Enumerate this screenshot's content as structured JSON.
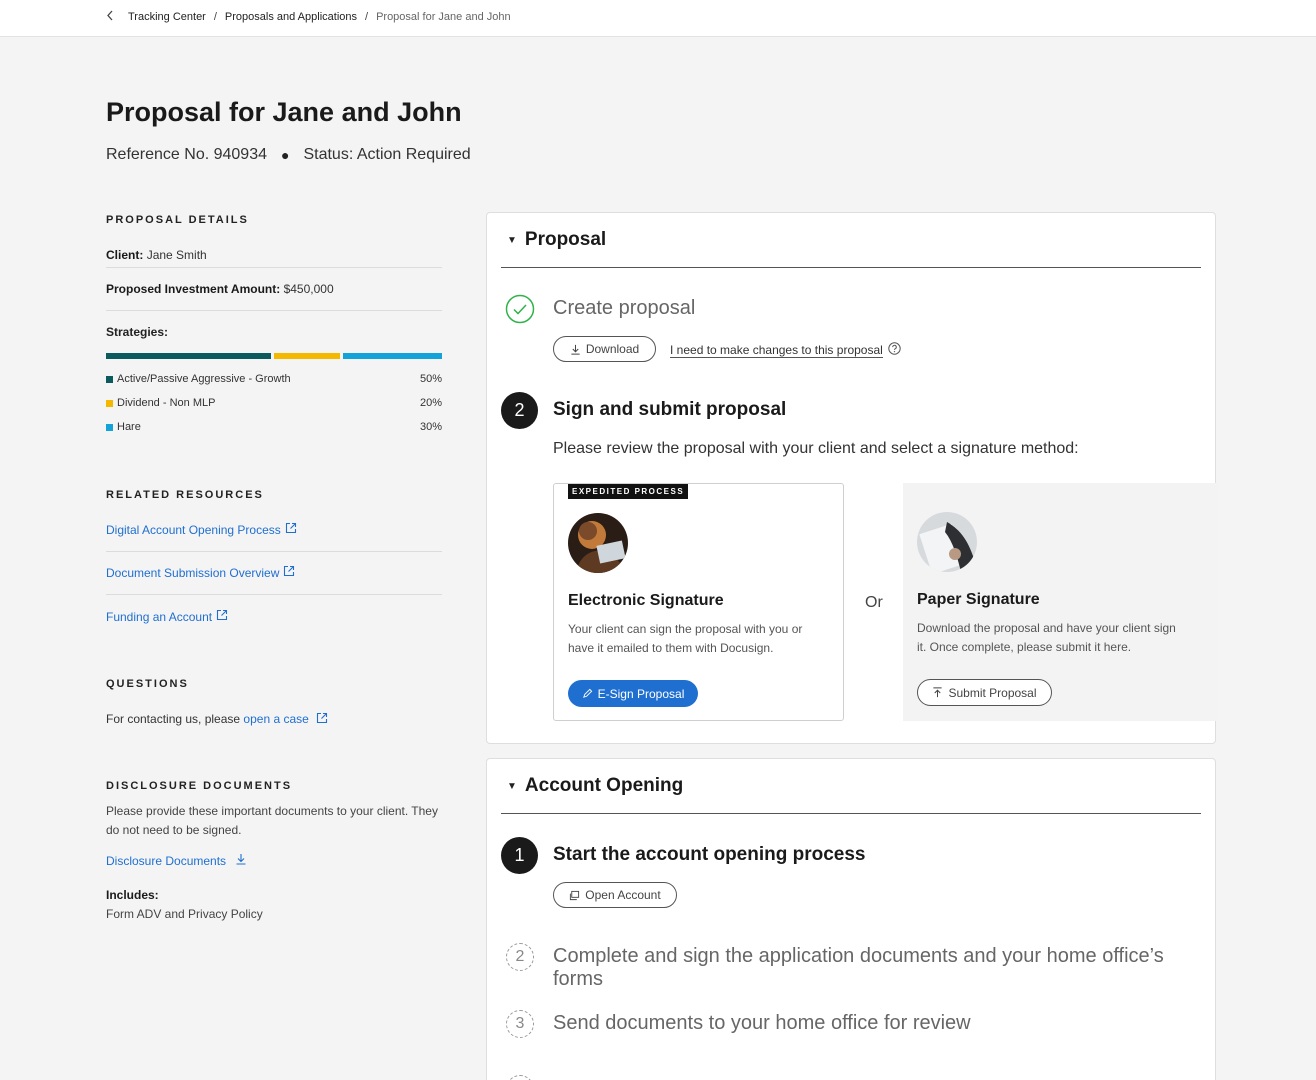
{
  "breadcrumb": {
    "back_icon": "chevron-left-icon",
    "items": [
      "Tracking Center",
      "Proposals and Applications",
      "Proposal for Jane and John"
    ],
    "separator": "/"
  },
  "page": {
    "title": "Proposal for Jane and John",
    "reference": "Reference No. 940934",
    "status": "Status: Action Required"
  },
  "details": {
    "heading": "PROPOSAL DETAILS",
    "client_label": "Client:",
    "client_value": "Jane Smith",
    "amount_label": "Proposed Investment Amount:",
    "amount_value": "$450,000",
    "strategies_label": "Strategies:",
    "strategies": [
      {
        "name": "Active/Passive Aggressive - Growth",
        "pct": "50%",
        "share": 0.5,
        "color": "#0b5b5e"
      },
      {
        "name": "Dividend - Non MLP",
        "pct": "20%",
        "share": 0.2,
        "color": "#f5b800"
      },
      {
        "name": "Hare",
        "pct": "30%",
        "share": 0.3,
        "color": "#14a3d8"
      }
    ]
  },
  "resources": {
    "heading": "RELATED RESOURCES",
    "links": [
      "Digital Account Opening Process",
      "Document Submission Overview",
      "Funding an Account"
    ]
  },
  "questions": {
    "heading": "QUESTIONS",
    "text": "For contacting us, please",
    "link": "open a case"
  },
  "disclosure": {
    "heading": "DISCLOSURE DOCUMENTS",
    "text": "Please provide these important documents to your client. They do not need to be signed.",
    "link": "Disclosure Documents",
    "includes_label": "Includes:",
    "includes_value": "Form ADV and Privacy Policy"
  },
  "proposal_card": {
    "title": "Proposal",
    "step1_title": "Create proposal",
    "download_label": "Download",
    "changes_link": "I need to make changes to this proposal",
    "step2_num": "2",
    "step2_title": "Sign and submit proposal",
    "step2_desc": "Please review the proposal with your client and select a signature method:",
    "or_label": "Or",
    "electronic": {
      "badge": "EXPEDITED PROCESS",
      "title": "Electronic Signature",
      "desc": "Your client can sign the proposal with you or have it emailed to them with Docusign.",
      "button": "E-Sign Proposal"
    },
    "paper": {
      "title": "Paper Signature",
      "desc": "Download the proposal and have your client sign it. Once complete, please submit it here.",
      "button": "Submit Proposal"
    }
  },
  "account_card": {
    "title": "Account Opening",
    "step1_num": "1",
    "step1_title": "Start the account opening process",
    "open_label": "Open Account",
    "step2_num": "2",
    "step2_title": "Complete and sign the application documents and your home office’s forms",
    "step3_num": "3",
    "step3_title": "Send documents to your home office for review"
  },
  "colors": {
    "accent": "#1f6fd1",
    "success": "#2fb34a"
  }
}
